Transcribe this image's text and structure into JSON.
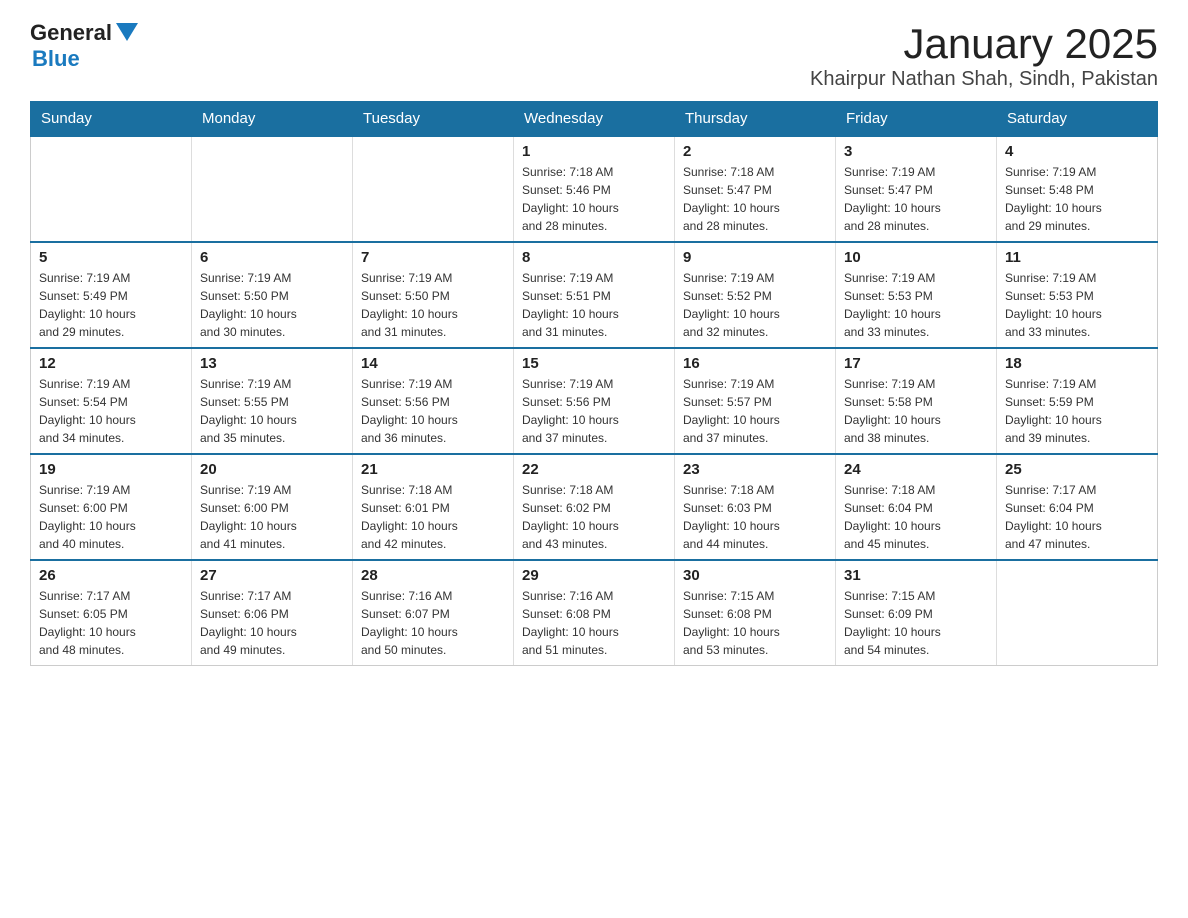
{
  "header": {
    "logo_general": "General",
    "logo_blue": "Blue",
    "title": "January 2025",
    "subtitle": "Khairpur Nathan Shah, Sindh, Pakistan"
  },
  "days_of_week": [
    "Sunday",
    "Monday",
    "Tuesday",
    "Wednesday",
    "Thursday",
    "Friday",
    "Saturday"
  ],
  "weeks": [
    [
      {
        "day": "",
        "info": ""
      },
      {
        "day": "",
        "info": ""
      },
      {
        "day": "",
        "info": ""
      },
      {
        "day": "1",
        "info": "Sunrise: 7:18 AM\nSunset: 5:46 PM\nDaylight: 10 hours\nand 28 minutes."
      },
      {
        "day": "2",
        "info": "Sunrise: 7:18 AM\nSunset: 5:47 PM\nDaylight: 10 hours\nand 28 minutes."
      },
      {
        "day": "3",
        "info": "Sunrise: 7:19 AM\nSunset: 5:47 PM\nDaylight: 10 hours\nand 28 minutes."
      },
      {
        "day": "4",
        "info": "Sunrise: 7:19 AM\nSunset: 5:48 PM\nDaylight: 10 hours\nand 29 minutes."
      }
    ],
    [
      {
        "day": "5",
        "info": "Sunrise: 7:19 AM\nSunset: 5:49 PM\nDaylight: 10 hours\nand 29 minutes."
      },
      {
        "day": "6",
        "info": "Sunrise: 7:19 AM\nSunset: 5:50 PM\nDaylight: 10 hours\nand 30 minutes."
      },
      {
        "day": "7",
        "info": "Sunrise: 7:19 AM\nSunset: 5:50 PM\nDaylight: 10 hours\nand 31 minutes."
      },
      {
        "day": "8",
        "info": "Sunrise: 7:19 AM\nSunset: 5:51 PM\nDaylight: 10 hours\nand 31 minutes."
      },
      {
        "day": "9",
        "info": "Sunrise: 7:19 AM\nSunset: 5:52 PM\nDaylight: 10 hours\nand 32 minutes."
      },
      {
        "day": "10",
        "info": "Sunrise: 7:19 AM\nSunset: 5:53 PM\nDaylight: 10 hours\nand 33 minutes."
      },
      {
        "day": "11",
        "info": "Sunrise: 7:19 AM\nSunset: 5:53 PM\nDaylight: 10 hours\nand 33 minutes."
      }
    ],
    [
      {
        "day": "12",
        "info": "Sunrise: 7:19 AM\nSunset: 5:54 PM\nDaylight: 10 hours\nand 34 minutes."
      },
      {
        "day": "13",
        "info": "Sunrise: 7:19 AM\nSunset: 5:55 PM\nDaylight: 10 hours\nand 35 minutes."
      },
      {
        "day": "14",
        "info": "Sunrise: 7:19 AM\nSunset: 5:56 PM\nDaylight: 10 hours\nand 36 minutes."
      },
      {
        "day": "15",
        "info": "Sunrise: 7:19 AM\nSunset: 5:56 PM\nDaylight: 10 hours\nand 37 minutes."
      },
      {
        "day": "16",
        "info": "Sunrise: 7:19 AM\nSunset: 5:57 PM\nDaylight: 10 hours\nand 37 minutes."
      },
      {
        "day": "17",
        "info": "Sunrise: 7:19 AM\nSunset: 5:58 PM\nDaylight: 10 hours\nand 38 minutes."
      },
      {
        "day": "18",
        "info": "Sunrise: 7:19 AM\nSunset: 5:59 PM\nDaylight: 10 hours\nand 39 minutes."
      }
    ],
    [
      {
        "day": "19",
        "info": "Sunrise: 7:19 AM\nSunset: 6:00 PM\nDaylight: 10 hours\nand 40 minutes."
      },
      {
        "day": "20",
        "info": "Sunrise: 7:19 AM\nSunset: 6:00 PM\nDaylight: 10 hours\nand 41 minutes."
      },
      {
        "day": "21",
        "info": "Sunrise: 7:18 AM\nSunset: 6:01 PM\nDaylight: 10 hours\nand 42 minutes."
      },
      {
        "day": "22",
        "info": "Sunrise: 7:18 AM\nSunset: 6:02 PM\nDaylight: 10 hours\nand 43 minutes."
      },
      {
        "day": "23",
        "info": "Sunrise: 7:18 AM\nSunset: 6:03 PM\nDaylight: 10 hours\nand 44 minutes."
      },
      {
        "day": "24",
        "info": "Sunrise: 7:18 AM\nSunset: 6:04 PM\nDaylight: 10 hours\nand 45 minutes."
      },
      {
        "day": "25",
        "info": "Sunrise: 7:17 AM\nSunset: 6:04 PM\nDaylight: 10 hours\nand 47 minutes."
      }
    ],
    [
      {
        "day": "26",
        "info": "Sunrise: 7:17 AM\nSunset: 6:05 PM\nDaylight: 10 hours\nand 48 minutes."
      },
      {
        "day": "27",
        "info": "Sunrise: 7:17 AM\nSunset: 6:06 PM\nDaylight: 10 hours\nand 49 minutes."
      },
      {
        "day": "28",
        "info": "Sunrise: 7:16 AM\nSunset: 6:07 PM\nDaylight: 10 hours\nand 50 minutes."
      },
      {
        "day": "29",
        "info": "Sunrise: 7:16 AM\nSunset: 6:08 PM\nDaylight: 10 hours\nand 51 minutes."
      },
      {
        "day": "30",
        "info": "Sunrise: 7:15 AM\nSunset: 6:08 PM\nDaylight: 10 hours\nand 53 minutes."
      },
      {
        "day": "31",
        "info": "Sunrise: 7:15 AM\nSunset: 6:09 PM\nDaylight: 10 hours\nand 54 minutes."
      },
      {
        "day": "",
        "info": ""
      }
    ]
  ]
}
